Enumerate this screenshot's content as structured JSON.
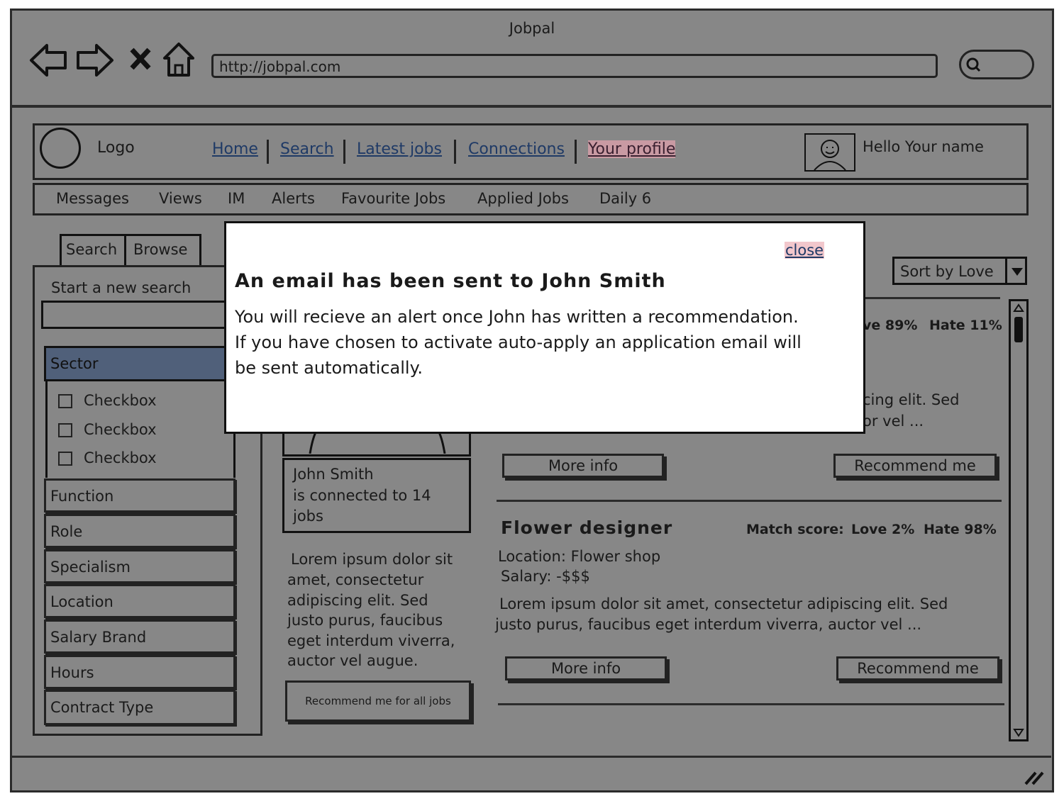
{
  "browser": {
    "title": "Jobpal",
    "url": "http://jobpal.com"
  },
  "header": {
    "logo_label": "Logo",
    "nav": [
      "Home",
      "Search",
      "Latest jobs",
      "Connections",
      "Your profile"
    ],
    "greeting": "Hello Your name"
  },
  "subnav": [
    "Messages",
    "Views",
    "IM",
    "Alerts",
    "Favourite Jobs",
    "Applied Jobs",
    "Daily 6"
  ],
  "sidebar": {
    "tabs": [
      "Search",
      "Browse"
    ],
    "start_label": "Start a new search",
    "sector": "Sector",
    "checkboxes": [
      "Checkbox",
      "Checkbox",
      "Checkbox"
    ],
    "filters": [
      "Function",
      "Role",
      "Specialism",
      "Location",
      "Salary Brand",
      "Hours",
      "Contract Type"
    ]
  },
  "connection": {
    "name": "John Smith",
    "line2": "is connected to 14",
    "line3": "jobs",
    "desc_lines": [
      "Lorem ipsum dolor sit",
      "amet, consectetur",
      "adipiscing elit. Sed",
      "justo purus, faucibus",
      "eget interdum viverra,",
      "auctor vel augue."
    ],
    "recommend_all": "Recommend me for all jobs"
  },
  "sort_label": "Sort by Love",
  "jobs": {
    "job1": {
      "score_partial": "ve 89%",
      "hate": "Hate 11%",
      "desc_partial_1": "cing elit. Sed",
      "desc_partial_2": "or vel ...",
      "more": "More info",
      "recommend": "Recommend me"
    },
    "job2": {
      "title": "Flower designer",
      "score_label": "Match score:",
      "love": "Love 2%",
      "hate": "Hate 98%",
      "location": "Location: Flower shop",
      "salary": "Salary: -$$$",
      "desc1": "Lorem ipsum dolor sit amet, consectetur adipiscing elit. Sed",
      "desc2": "justo purus, faucibus eget interdum viverra, auctor vel ...",
      "more": "More info",
      "recommend": "Recommend me"
    }
  },
  "modal": {
    "close": "close",
    "title": "An email has been sent to John Smith",
    "line1": "You will recieve an alert once John has written a recommendation.",
    "line2": "If you have chosen to activate auto-apply an application email will",
    "line3": "be sent automatically."
  }
}
